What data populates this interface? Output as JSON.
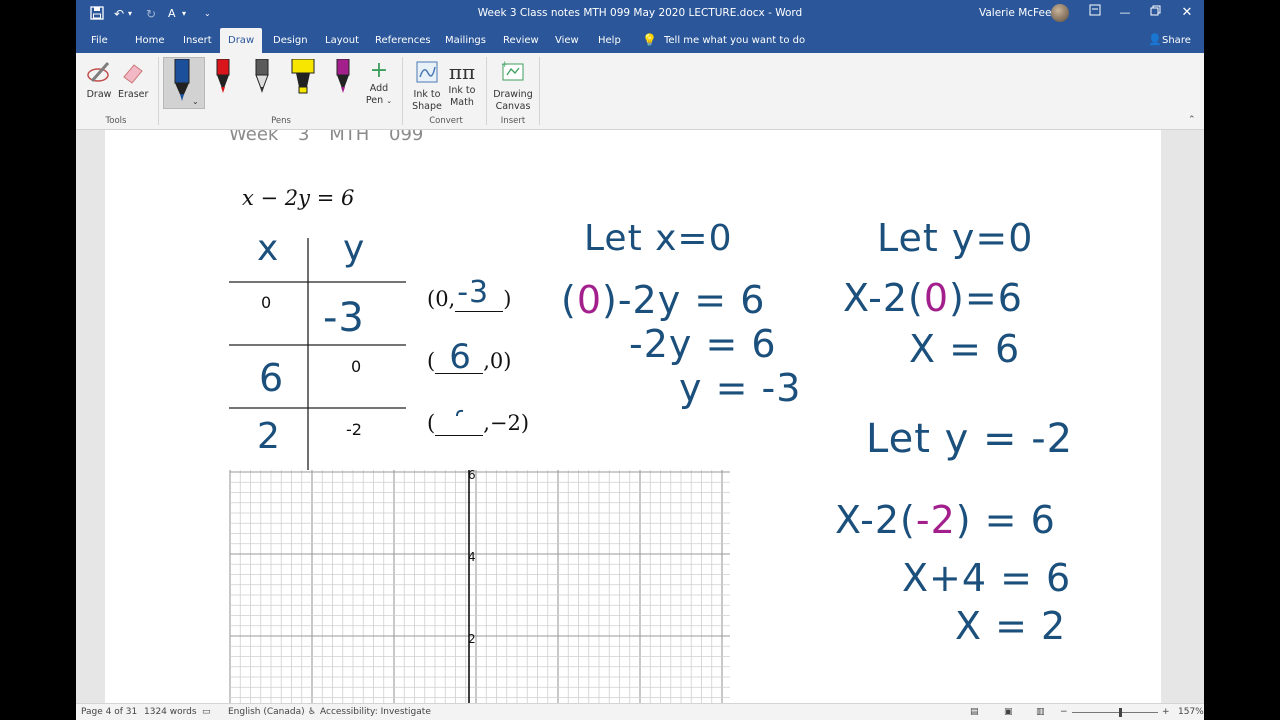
{
  "titlebar": {
    "doc_title": "Week 3 Class notes MTH 099 May 2020 LECTURE.docx  -  Word",
    "user": "Valerie McFee"
  },
  "tabs": [
    "File",
    "Home",
    "Insert",
    "Draw",
    "Design",
    "Layout",
    "References",
    "Mailings",
    "Review",
    "View",
    "Help"
  ],
  "active_tab": "Draw",
  "tellme": "Tell me what you want to do",
  "share": "Share",
  "ribbon": {
    "draw": "Draw",
    "eraser": "Eraser",
    "tools_group": "Tools",
    "pens_group": "Pens",
    "add_pen_line1": "Add",
    "add_pen_line2": "Pen",
    "ink_to_shape_1": "Ink to",
    "ink_to_shape_2": "Shape",
    "ink_to_math_1": "Ink to",
    "ink_to_math_2": "Math",
    "convert_group": "Convert",
    "drawing_canvas_1": "Drawing",
    "drawing_canvas_2": "Canvas",
    "insert_group": "Insert",
    "pen_colors": [
      "#1b4f9c",
      "#d9141b",
      "#5a5a5a",
      "#f6e600",
      "#a3208c"
    ]
  },
  "document": {
    "header": "Week 3    MTH 099",
    "equation": "x − 2y = 6",
    "table": {
      "col_x": "x",
      "col_y": "y",
      "row1_x": "0",
      "row1_y": "-3",
      "row2_x": "6",
      "row2_y": "0",
      "row3_x": "2",
      "row3_y": "-2"
    },
    "pairs": {
      "p1_open": "(0,",
      "p1_fill": "-3",
      "p1_close": ")",
      "p2_open": "(",
      "p2_fill": "6",
      "p2_close": ",0)",
      "p3_open": "(",
      "p3_close": ",−2)"
    },
    "work_x0": {
      "l1": "Let x=0",
      "l2_a": "(",
      "l2_b": "0",
      "l2_c": ")-2y = 6",
      "l3": "-2y = 6",
      "l4": "y = -3"
    },
    "work_y0": {
      "l1": "Let y=0",
      "l2_a": "X-2(",
      "l2_b": "0",
      "l2_c": ")=6",
      "l3": "X  = 6"
    },
    "work_y_neg2": {
      "l1": "Let  y = -2",
      "l2_a": "X-2(",
      "l2_b": "-2",
      "l2_c": ") = 6",
      "l3": "X+4  = 6",
      "l4": "X = 2"
    },
    "graph_labels": [
      "6",
      "4",
      "2"
    ]
  },
  "status": {
    "page": "Page 4 of 31",
    "words": "1324 words",
    "language": "English (Canada)",
    "accessibility": "Accessibility: Investigate",
    "zoom": "157%"
  }
}
